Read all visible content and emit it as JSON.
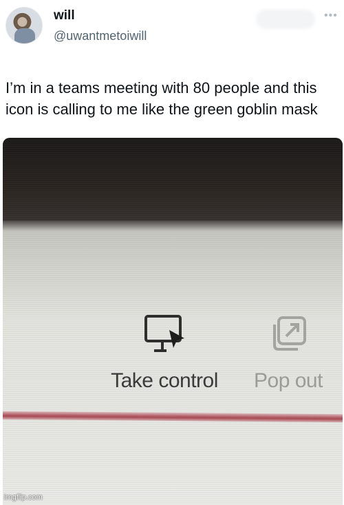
{
  "tweet": {
    "display_name": "will",
    "handle": "@uwantmetoiwill",
    "more_icon": "more-horizontal-icon",
    "text_line_1": "I’m in a teams meeting with 80 people and this",
    "text_line_2": "icon is calling to me like the green goblin mask"
  },
  "photo": {
    "controls": [
      {
        "label": "Take control",
        "icon": "monitor-cursor-icon",
        "color": "#3b3b3a"
      },
      {
        "label": "Pop out",
        "icon": "pop-out-window-icon",
        "color": "#9b9b98"
      }
    ],
    "accent_line_color": "#a94c55"
  },
  "watermark": "imgflip.com"
}
